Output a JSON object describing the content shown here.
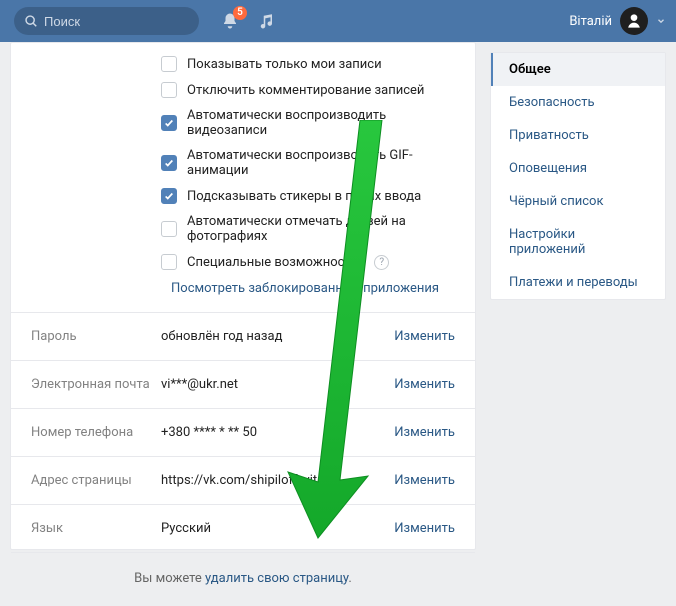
{
  "header": {
    "search_placeholder": "Поиск",
    "notif_badge": "5",
    "user_name": "Віталій"
  },
  "checkboxes": [
    {
      "label": "Показывать только мои записи",
      "checked": false
    },
    {
      "label": "Отключить комментирование записей",
      "checked": false
    },
    {
      "label": "Автоматически воспроизводить видеозаписи",
      "checked": true
    },
    {
      "label": "Автоматически воспроизводить GIF-анимации",
      "checked": true
    },
    {
      "label": "Подсказывать стикеры в полях ввода",
      "checked": true
    },
    {
      "label": "Автоматически отмечать друзей на фотографиях",
      "checked": false
    },
    {
      "label": "Специальные возможности",
      "checked": false,
      "hint": true
    }
  ],
  "blocked_apps_link": "Посмотреть заблокированные приложения",
  "rows": [
    {
      "label": "Пароль",
      "value": "обновлён год назад",
      "action": "Изменить"
    },
    {
      "label": "Электронная почта",
      "value": "vi***@ukr.net",
      "action": "Изменить"
    },
    {
      "label": "Номер телефона",
      "value": "+380 **** * ** 50",
      "action": "Изменить"
    },
    {
      "label": "Адрес страницы",
      "value": "https://vk.com/shipiloff_vitalik",
      "action": "Изменить"
    },
    {
      "label": "Язык",
      "value": "Русский",
      "action": "Изменить"
    }
  ],
  "delete": {
    "prefix": "Вы можете ",
    "link": "удалить свою страницу",
    "suffix": "."
  },
  "sidebar": [
    {
      "label": "Общее",
      "active": true
    },
    {
      "label": "Безопасность",
      "active": false
    },
    {
      "label": "Приватность",
      "active": false
    },
    {
      "label": "Оповещения",
      "active": false
    },
    {
      "label": "Чёрный список",
      "active": false
    },
    {
      "label": "Настройки приложений",
      "active": false
    },
    {
      "label": "Платежи и переводы",
      "active": false
    }
  ]
}
